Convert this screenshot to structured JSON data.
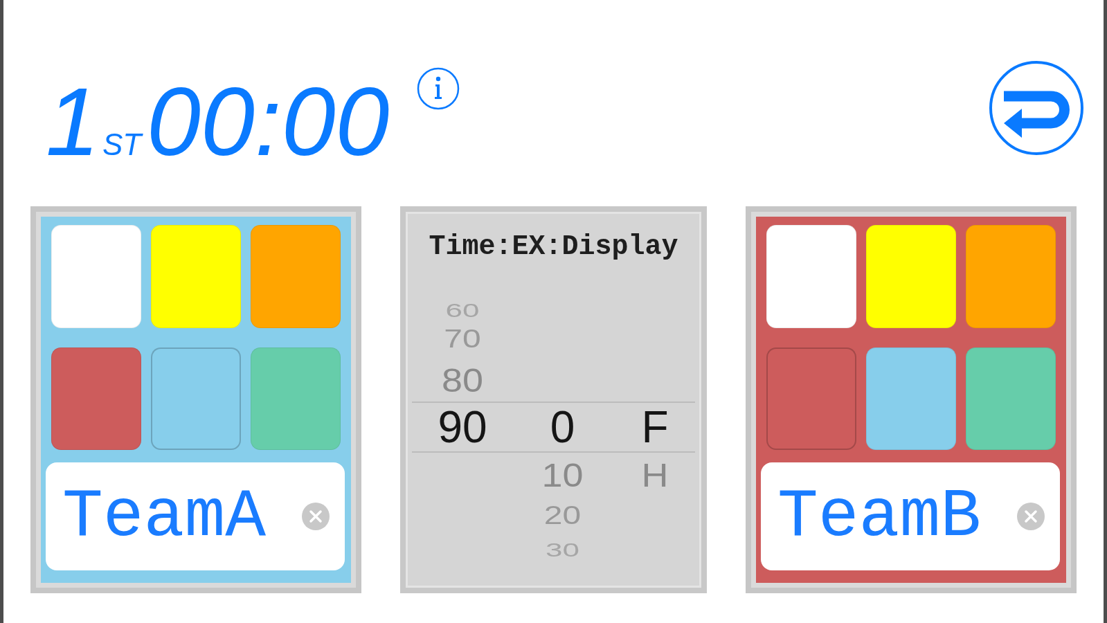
{
  "period": {
    "number": "1",
    "suffix": "ST"
  },
  "clock": "00:00",
  "panels": [
    {
      "kind": "team",
      "name": "TeamA",
      "swatches": [
        {
          "color": "#ffffff",
          "selected": false
        },
        {
          "color": "#ffff00",
          "selected": false
        },
        {
          "color": "#ffa500",
          "selected": false
        },
        {
          "color": "#cd5c5c",
          "selected": false
        },
        {
          "color": "#87ceeb",
          "selected": true
        },
        {
          "color": "#66cdaa",
          "selected": false
        }
      ]
    },
    {
      "kind": "picker",
      "title": "Time:EX:Display",
      "columns": [
        {
          "items": [
            {
              "label": "60",
              "selected": false
            },
            {
              "label": "70",
              "selected": false
            },
            {
              "label": "80",
              "selected": false
            },
            {
              "label": "90",
              "selected": true
            }
          ]
        },
        {
          "items": [
            {
              "label": "0",
              "selected": true
            },
            {
              "label": "10",
              "selected": false
            },
            {
              "label": "20",
              "selected": false
            },
            {
              "label": "30",
              "selected": false
            }
          ]
        },
        {
          "items": [
            {
              "label": "F",
              "selected": true
            },
            {
              "label": "H",
              "selected": false
            }
          ]
        }
      ]
    },
    {
      "kind": "team",
      "name": "TeamB",
      "swatches": [
        {
          "color": "#ffffff",
          "selected": false
        },
        {
          "color": "#ffff00",
          "selected": false
        },
        {
          "color": "#ffa500",
          "selected": false
        },
        {
          "color": "#cd5c5c",
          "selected": true
        },
        {
          "color": "#87ceeb",
          "selected": false
        },
        {
          "color": "#66cdaa",
          "selected": false
        }
      ]
    }
  ]
}
